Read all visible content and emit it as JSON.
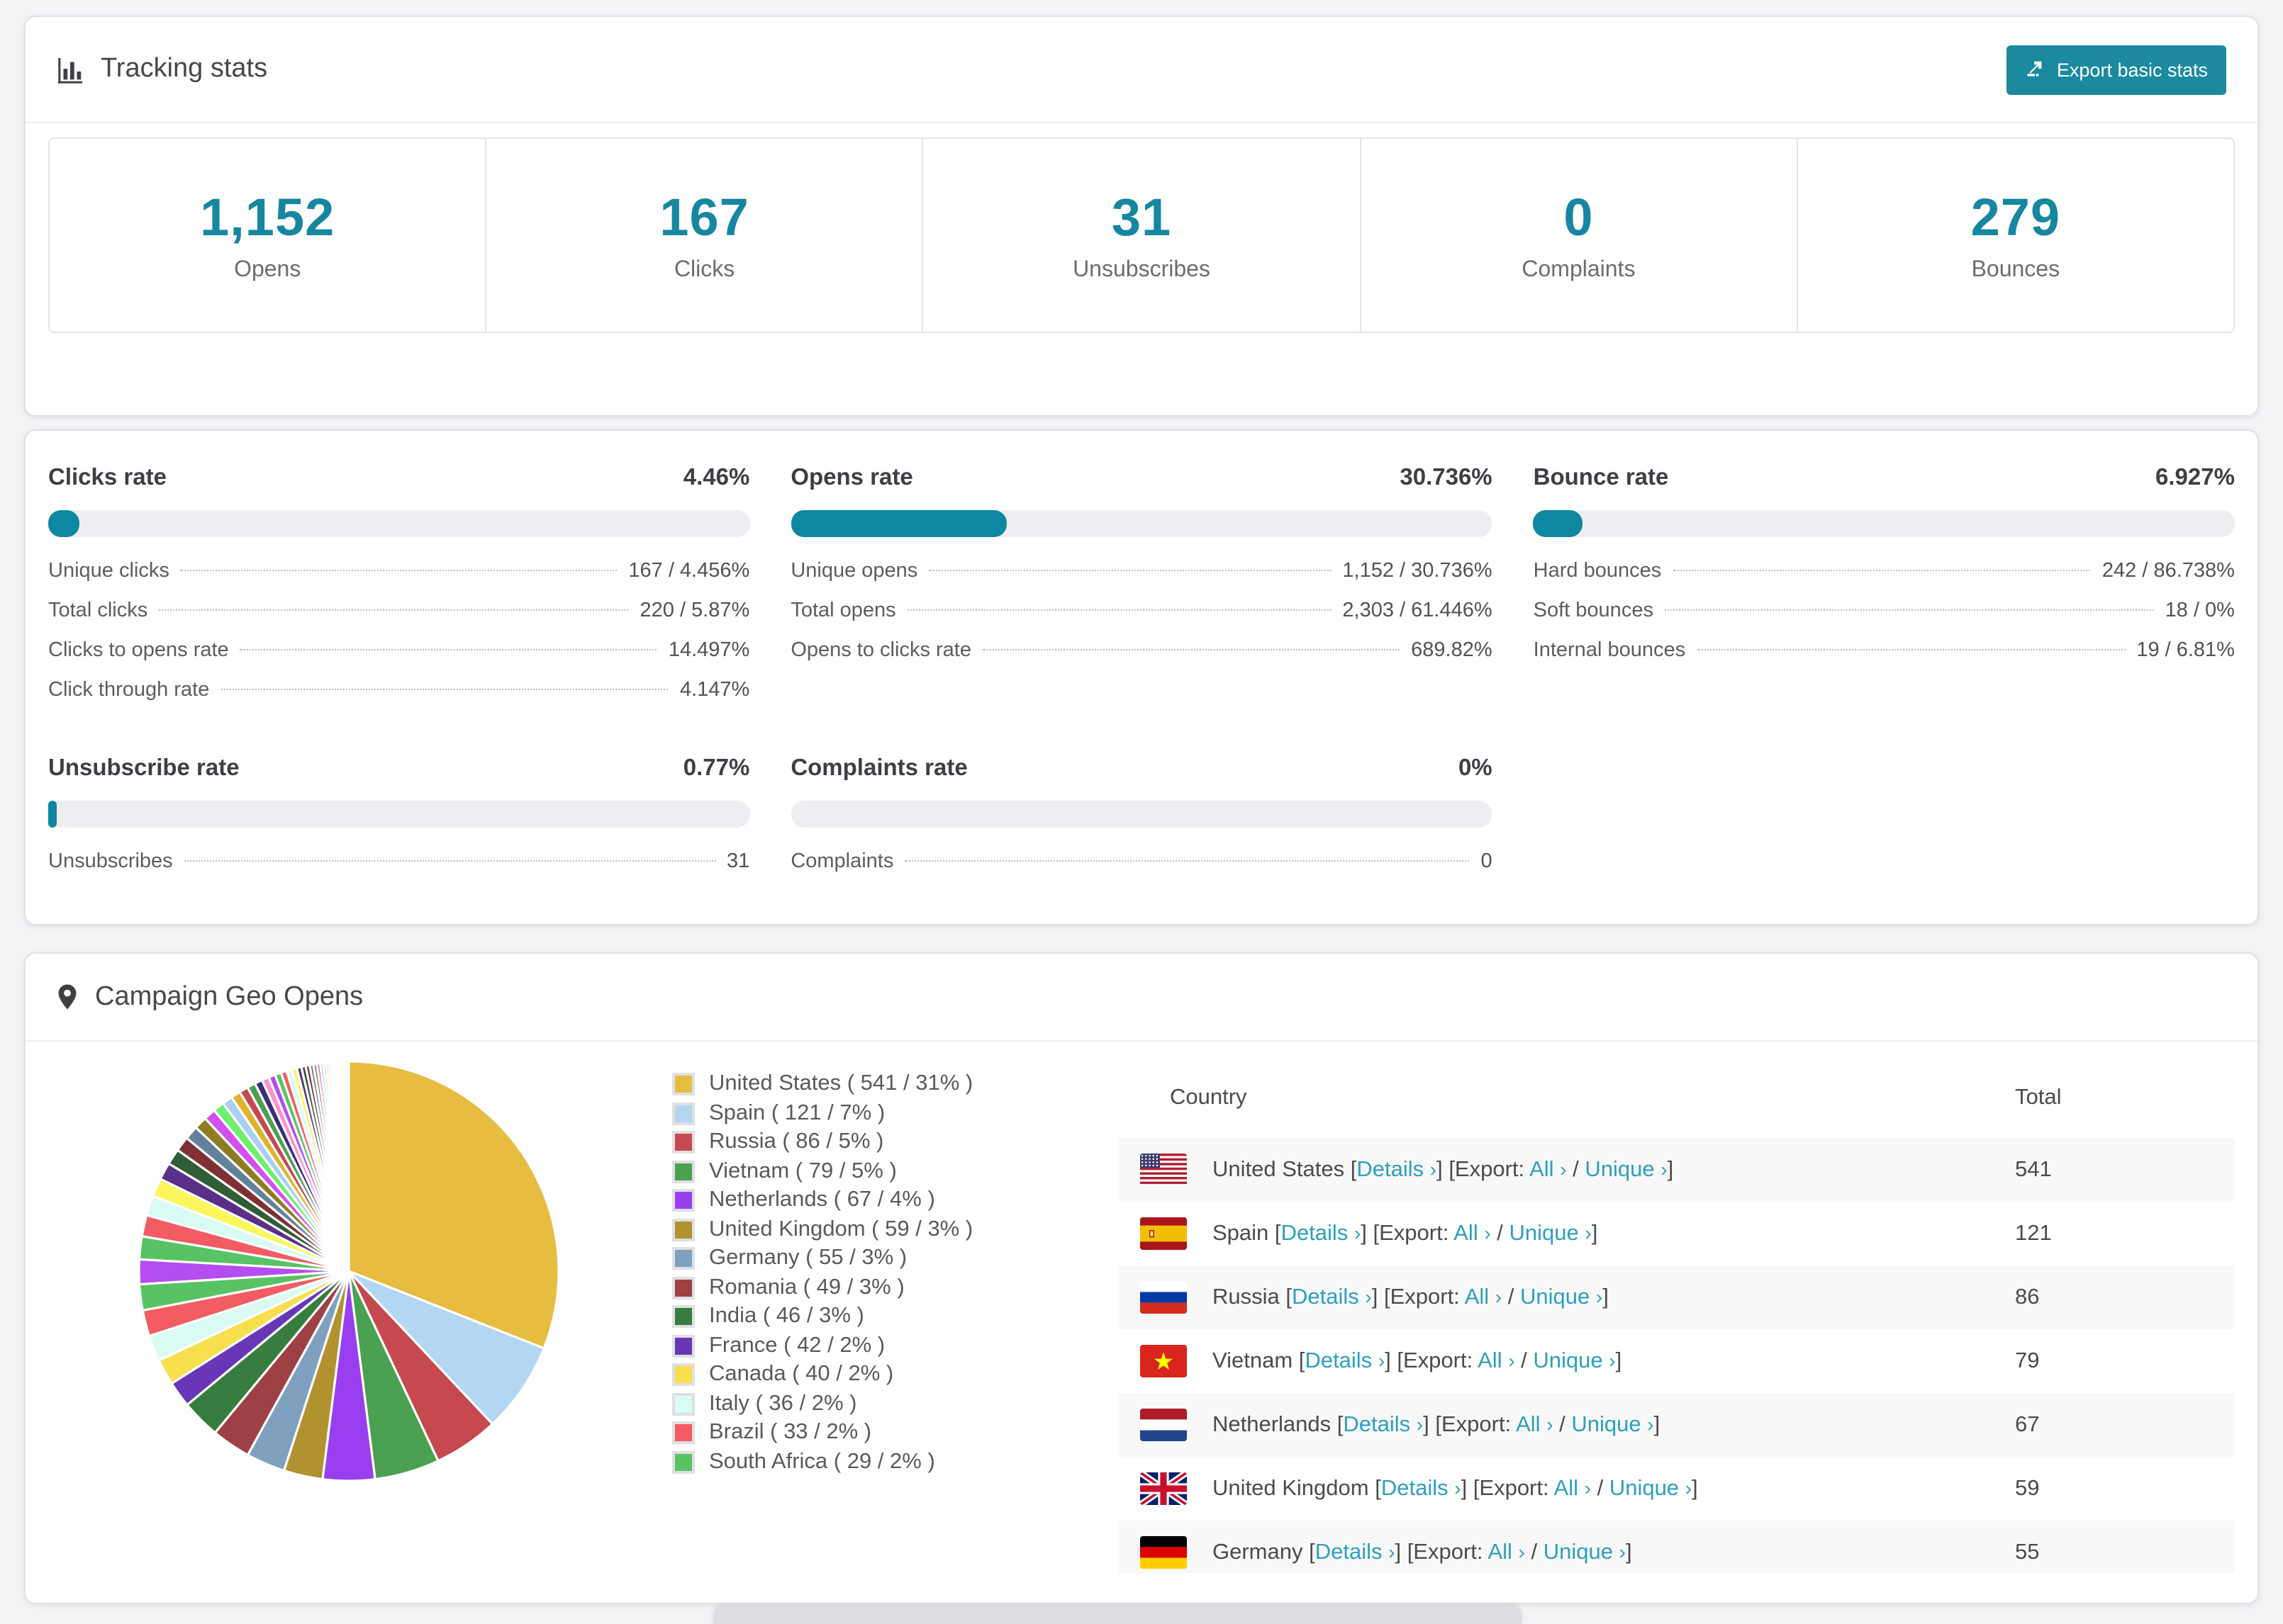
{
  "brand": {
    "teal": "#1786a0",
    "button_teal": "#1b8a9e",
    "link_teal": "#2d9fbe"
  },
  "tracking": {
    "title": "Tracking stats",
    "export_button": "Export basic stats",
    "stats": [
      {
        "value": "1,152",
        "label": "Opens"
      },
      {
        "value": "167",
        "label": "Clicks"
      },
      {
        "value": "31",
        "label": "Unsubscribes"
      },
      {
        "value": "0",
        "label": "Complaints"
      },
      {
        "value": "279",
        "label": "Bounces"
      }
    ]
  },
  "rates": [
    {
      "title": "Clicks rate",
      "value": "4.46%",
      "bar_pct": 4.46,
      "rows": [
        [
          "Unique clicks",
          "167 / 4.456%"
        ],
        [
          "Total clicks",
          "220 / 5.87%"
        ],
        [
          "Clicks to opens rate",
          "14.497%"
        ],
        [
          "Click through rate",
          "4.147%"
        ]
      ]
    },
    {
      "title": "Opens rate",
      "value": "30.736%",
      "bar_pct": 30.736,
      "rows": [
        [
          "Unique opens",
          "1,152 / 30.736%"
        ],
        [
          "Total opens",
          "2,303 / 61.446%"
        ],
        [
          "Opens to clicks rate",
          "689.82%"
        ]
      ]
    },
    {
      "title": "Bounce rate",
      "value": "6.927%",
      "bar_pct": 6.927,
      "rows": [
        [
          "Hard bounces",
          "242 / 86.738%"
        ],
        [
          "Soft bounces",
          "18 / 0%"
        ],
        [
          "Internal bounces",
          "19 / 6.81%"
        ]
      ]
    },
    {
      "title": "Unsubscribe rate",
      "value": "0.77%",
      "bar_pct": 0.77,
      "rows": [
        [
          "Unsubscribes",
          "31"
        ]
      ]
    },
    {
      "title": "Complaints rate",
      "value": "0%",
      "bar_pct": 0,
      "rows": [
        [
          "Complaints",
          "0"
        ]
      ]
    }
  ],
  "geo": {
    "title": "Campaign Geo Opens",
    "table_headers": {
      "country": "Country",
      "total": "Total"
    },
    "link_labels": {
      "details": "Details",
      "export": "Export:",
      "all": "All",
      "unique": "Unique",
      "chevron": "›"
    },
    "rows": [
      {
        "country": "United States",
        "total": "541",
        "flag": "us"
      },
      {
        "country": "Spain",
        "total": "121",
        "flag": "es"
      },
      {
        "country": "Russia",
        "total": "86",
        "flag": "ru"
      },
      {
        "country": "Vietnam",
        "total": "79",
        "flag": "vn"
      },
      {
        "country": "Netherlands",
        "total": "67",
        "flag": "nl"
      },
      {
        "country": "United Kingdom",
        "total": "59",
        "flag": "gb"
      },
      {
        "country": "Germany",
        "total": "55",
        "flag": "de"
      }
    ]
  },
  "chart_data": {
    "type": "pie",
    "title": "Campaign Geo Opens",
    "legend_position": "right",
    "start_angle_deg": -90,
    "direction": "clockwise",
    "slices": [
      {
        "label": "United States",
        "value": 541,
        "pct": 31,
        "color": "#e6bd41"
      },
      {
        "label": "Spain",
        "value": 121,
        "pct": 7,
        "color": "#b3d6f2"
      },
      {
        "label": "Russia",
        "value": 86,
        "pct": 5,
        "color": "#c5494f"
      },
      {
        "label": "Vietnam",
        "value": 79,
        "pct": 5,
        "color": "#4ba152"
      },
      {
        "label": "Netherlands",
        "value": 67,
        "pct": 4,
        "color": "#9a3ff0"
      },
      {
        "label": "United Kingdom",
        "value": 59,
        "pct": 3,
        "color": "#b2922f"
      },
      {
        "label": "Germany",
        "value": 55,
        "pct": 3,
        "color": "#7fa0bf"
      },
      {
        "label": "Romania",
        "value": 49,
        "pct": 3,
        "color": "#9e4145"
      },
      {
        "label": "India",
        "value": 46,
        "pct": 3,
        "color": "#377d40"
      },
      {
        "label": "France",
        "value": 42,
        "pct": 2,
        "color": "#6737b8"
      },
      {
        "label": "Canada",
        "value": 40,
        "pct": 2,
        "color": "#f7df4e"
      },
      {
        "label": "Italy",
        "value": 36,
        "pct": 2,
        "color": "#d9fbf3"
      },
      {
        "label": "Brazil",
        "value": 33,
        "pct": 2,
        "color": "#f25c62"
      },
      {
        "label": "South Africa",
        "value": 29,
        "pct": 2,
        "color": "#58c363"
      }
    ],
    "others_share_pct": 26,
    "others_slice_count": 44,
    "others_palette": [
      "#b44ef0",
      "#58c363",
      "#f25c62",
      "#d9fbf3",
      "#f9f75c",
      "#5a2f88",
      "#2f5d36",
      "#7e3034",
      "#64819c",
      "#8f7c22",
      "#d44ff0",
      "#6ef06e",
      "#a8d0f0",
      "#e0b32e",
      "#c5494f",
      "#4ba152",
      "#3b2f78",
      "#ff8fd0"
    ]
  }
}
